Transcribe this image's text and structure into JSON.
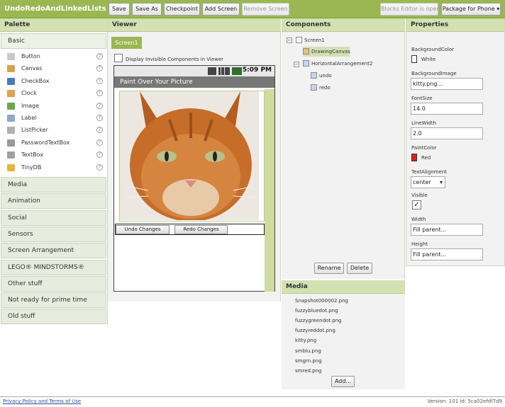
{
  "app": {
    "title": "UndoRedoAndLinkedLists"
  },
  "toolbar": {
    "save": "Save",
    "save_as": "Save As",
    "checkpoint": "Checkpoint",
    "add_screen": "Add Screen",
    "remove_screen": "Remove Screen",
    "blocks_editor": "Blocks Editor is open",
    "package": "Package for Phone ▾"
  },
  "palette": {
    "header": "Palette",
    "basic_label": "Basic",
    "items": [
      {
        "label": "Button",
        "icon": "button-icon",
        "color": "#c8c8c8"
      },
      {
        "label": "Canvas",
        "icon": "canvas-icon",
        "color": "#d9a24a"
      },
      {
        "label": "CheckBox",
        "icon": "checkbox-icon",
        "color": "#4a78c8"
      },
      {
        "label": "Clock",
        "icon": "clock-icon",
        "color": "#e0a050"
      },
      {
        "label": "Image",
        "icon": "image-icon",
        "color": "#6aa84f"
      },
      {
        "label": "Label",
        "icon": "label-icon",
        "color": "#8fa8c8"
      },
      {
        "label": "ListPicker",
        "icon": "listpicker-icon",
        "color": "#b0b0b0"
      },
      {
        "label": "PasswordTextBox",
        "icon": "password-icon",
        "color": "#9a9a9a"
      },
      {
        "label": "TextBox",
        "icon": "textbox-icon",
        "color": "#a0a0a0"
      },
      {
        "label": "TinyDB",
        "icon": "database-icon",
        "color": "#e0b840"
      }
    ],
    "help_glyph": "?",
    "categories": [
      "Media",
      "Animation",
      "Social",
      "Sensors",
      "Screen Arrangement",
      "LEGO® MINDSTORMS®",
      "Other stuff",
      "Not ready for prime time",
      "Old stuff"
    ]
  },
  "viewer": {
    "header": "Viewer",
    "screen_tab": "Screen1",
    "invisible_label": "Display Invisible Components in Viewer",
    "time": "5:09 PM",
    "app_title": "Paint Over Your Picture",
    "undo_button": "Undo Changes",
    "redo_button": "Redo Changes"
  },
  "components": {
    "header": "Components",
    "tree": {
      "screen": "Screen1",
      "canvas": "DrawingCanvas",
      "arrangement": "HorizontalArrangement2",
      "undo": "undo",
      "redo": "redo"
    },
    "rename": "Rename",
    "delete": "Delete"
  },
  "media": {
    "header": "Media",
    "files": [
      "Snapshot000002.png",
      "fuzzybluedot.png",
      "fuzzygreendot.png",
      "fuzzyreddot.png",
      "kitty.png",
      "smblu.png",
      "smgrn.png",
      "smred.png"
    ],
    "add": "Add..."
  },
  "properties": {
    "header": "Properties",
    "background_color_label": "BackgroundColor",
    "background_color_value": "White",
    "background_image_label": "BackgroundImage",
    "background_image_value": "kitty.png...",
    "font_size_label": "FontSize",
    "font_size_value": "14.0",
    "line_width_label": "LineWidth",
    "line_width_value": "2.0",
    "paint_color_label": "PaintColor",
    "paint_color_value": "Red",
    "text_alignment_label": "TextAlignment",
    "text_alignment_value": "center",
    "visible_label": "Visible",
    "width_label": "Width",
    "width_value": "Fill parent...",
    "height_label": "Height",
    "height_value": "Fill parent..."
  },
  "footer": {
    "privacy": "Privacy Policy and Terms of Use",
    "version": "Version: 101 Id: 5ca02efdf7d9"
  },
  "colors": {
    "brand_green": "#9ab752",
    "panel_header": "#d5e0b3",
    "paint_red": "#e02020",
    "bg_white": "#ffffff"
  }
}
